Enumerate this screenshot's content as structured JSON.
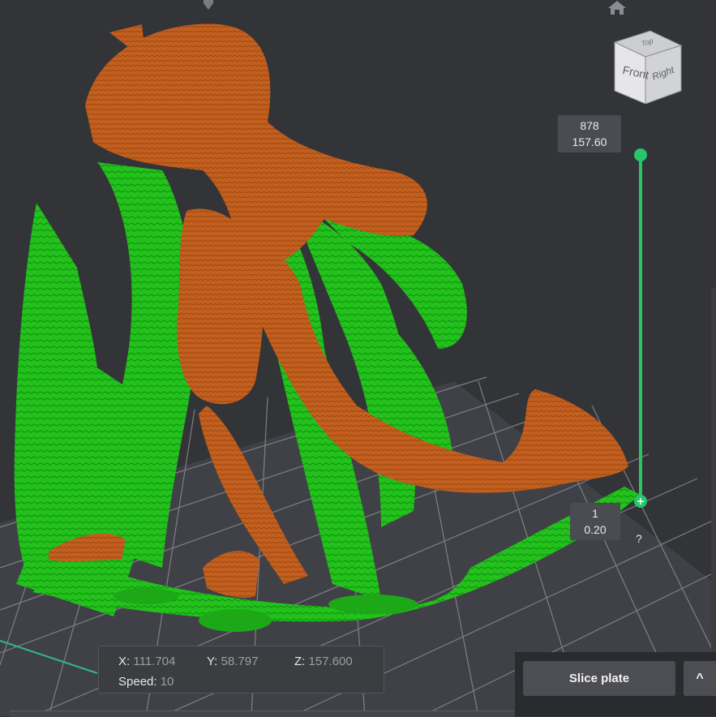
{
  "colors": {
    "background": "#333438",
    "plate_grid": "#8a8b90",
    "model": "#c05d1c",
    "support": "#1ec31a",
    "slider_accent": "#28c56a",
    "panel": "#3c3d41"
  },
  "icons": {
    "home": "home-icon",
    "top_arrow": "arrow-down-icon"
  },
  "view_cube": {
    "top_label": "Top",
    "front_label": "Front",
    "right_label": "Right"
  },
  "layer_slider": {
    "top_layer": "878",
    "top_height": "157.60",
    "bottom_layer": "1",
    "bottom_height": "0.20",
    "help": "?"
  },
  "position_info": {
    "x_label": "X:",
    "x_value": "111.704",
    "y_label": "Y:",
    "y_value": "58.797",
    "z_label": "Z:",
    "z_value": "157.600",
    "speed_label": "Speed:",
    "speed_value": "10"
  },
  "actions": {
    "slice_label": "Slice plate",
    "expand_label": "^"
  }
}
